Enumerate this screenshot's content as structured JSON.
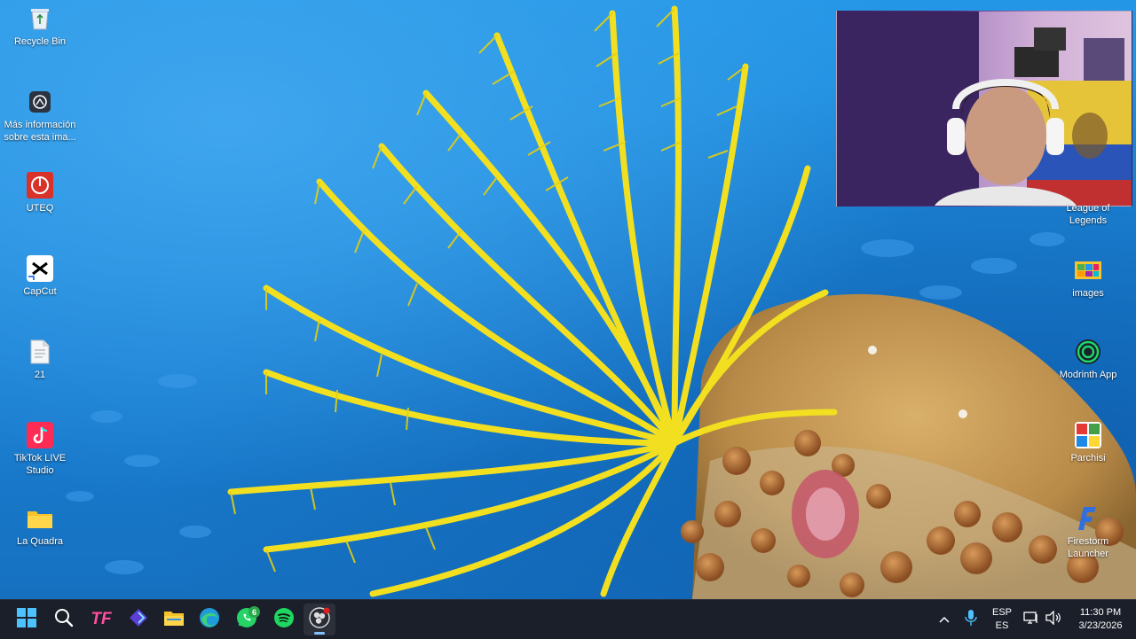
{
  "desktop": {
    "left_icons": [
      {
        "label": "Recycle Bin",
        "icon": "recycle-bin-icon"
      },
      {
        "label": "Más información\nsobre esta ima...",
        "icon": "info-camera-icon"
      },
      {
        "label": "UTEQ",
        "icon": "uteq-icon"
      },
      {
        "label": "CapCut",
        "icon": "capcut-icon"
      },
      {
        "label": "21",
        "icon": "document-icon"
      },
      {
        "label": "TikTok LIVE\nStudio",
        "icon": "tiktok-live-icon"
      },
      {
        "label": "La Quadra",
        "icon": "folder-icon"
      }
    ],
    "right_icons": [
      {
        "label": "League of\nLegends",
        "icon": "league-of-legends-icon"
      },
      {
        "label": "images",
        "icon": "images-icon"
      },
      {
        "label": "Modrinth App",
        "icon": "modrinth-icon"
      },
      {
        "label": "Parchisi",
        "icon": "parchisi-icon"
      },
      {
        "label": "Firestorm\nLauncher",
        "icon": "firestorm-icon"
      }
    ]
  },
  "taskbar": {
    "apps": [
      {
        "name": "start",
        "icon": "windows-start-icon"
      },
      {
        "name": "search",
        "icon": "search-icon"
      },
      {
        "name": "tf",
        "icon": "tf-app-icon",
        "text": "TF"
      },
      {
        "name": "app-diamond",
        "icon": "diamond-app-icon"
      },
      {
        "name": "file-explorer",
        "icon": "file-explorer-icon"
      },
      {
        "name": "edge",
        "icon": "edge-browser-icon"
      },
      {
        "name": "whatsapp",
        "icon": "whatsapp-icon",
        "badge": "6"
      },
      {
        "name": "spotify",
        "icon": "spotify-icon"
      },
      {
        "name": "obs",
        "icon": "obs-icon"
      }
    ],
    "tray": {
      "chevron": "chevron-up-icon",
      "mic": "microphone-icon",
      "lang_top": "ESP",
      "lang_bottom": "ES",
      "network": "network-icon",
      "volume": "volume-icon",
      "time": "11:30 PM",
      "date": "3/23/2026"
    }
  },
  "colors": {
    "taskbar_bg": "#1b1f2a",
    "crinoid_yellow": "#f2e020",
    "ocean_blue": "#1c86d6"
  }
}
